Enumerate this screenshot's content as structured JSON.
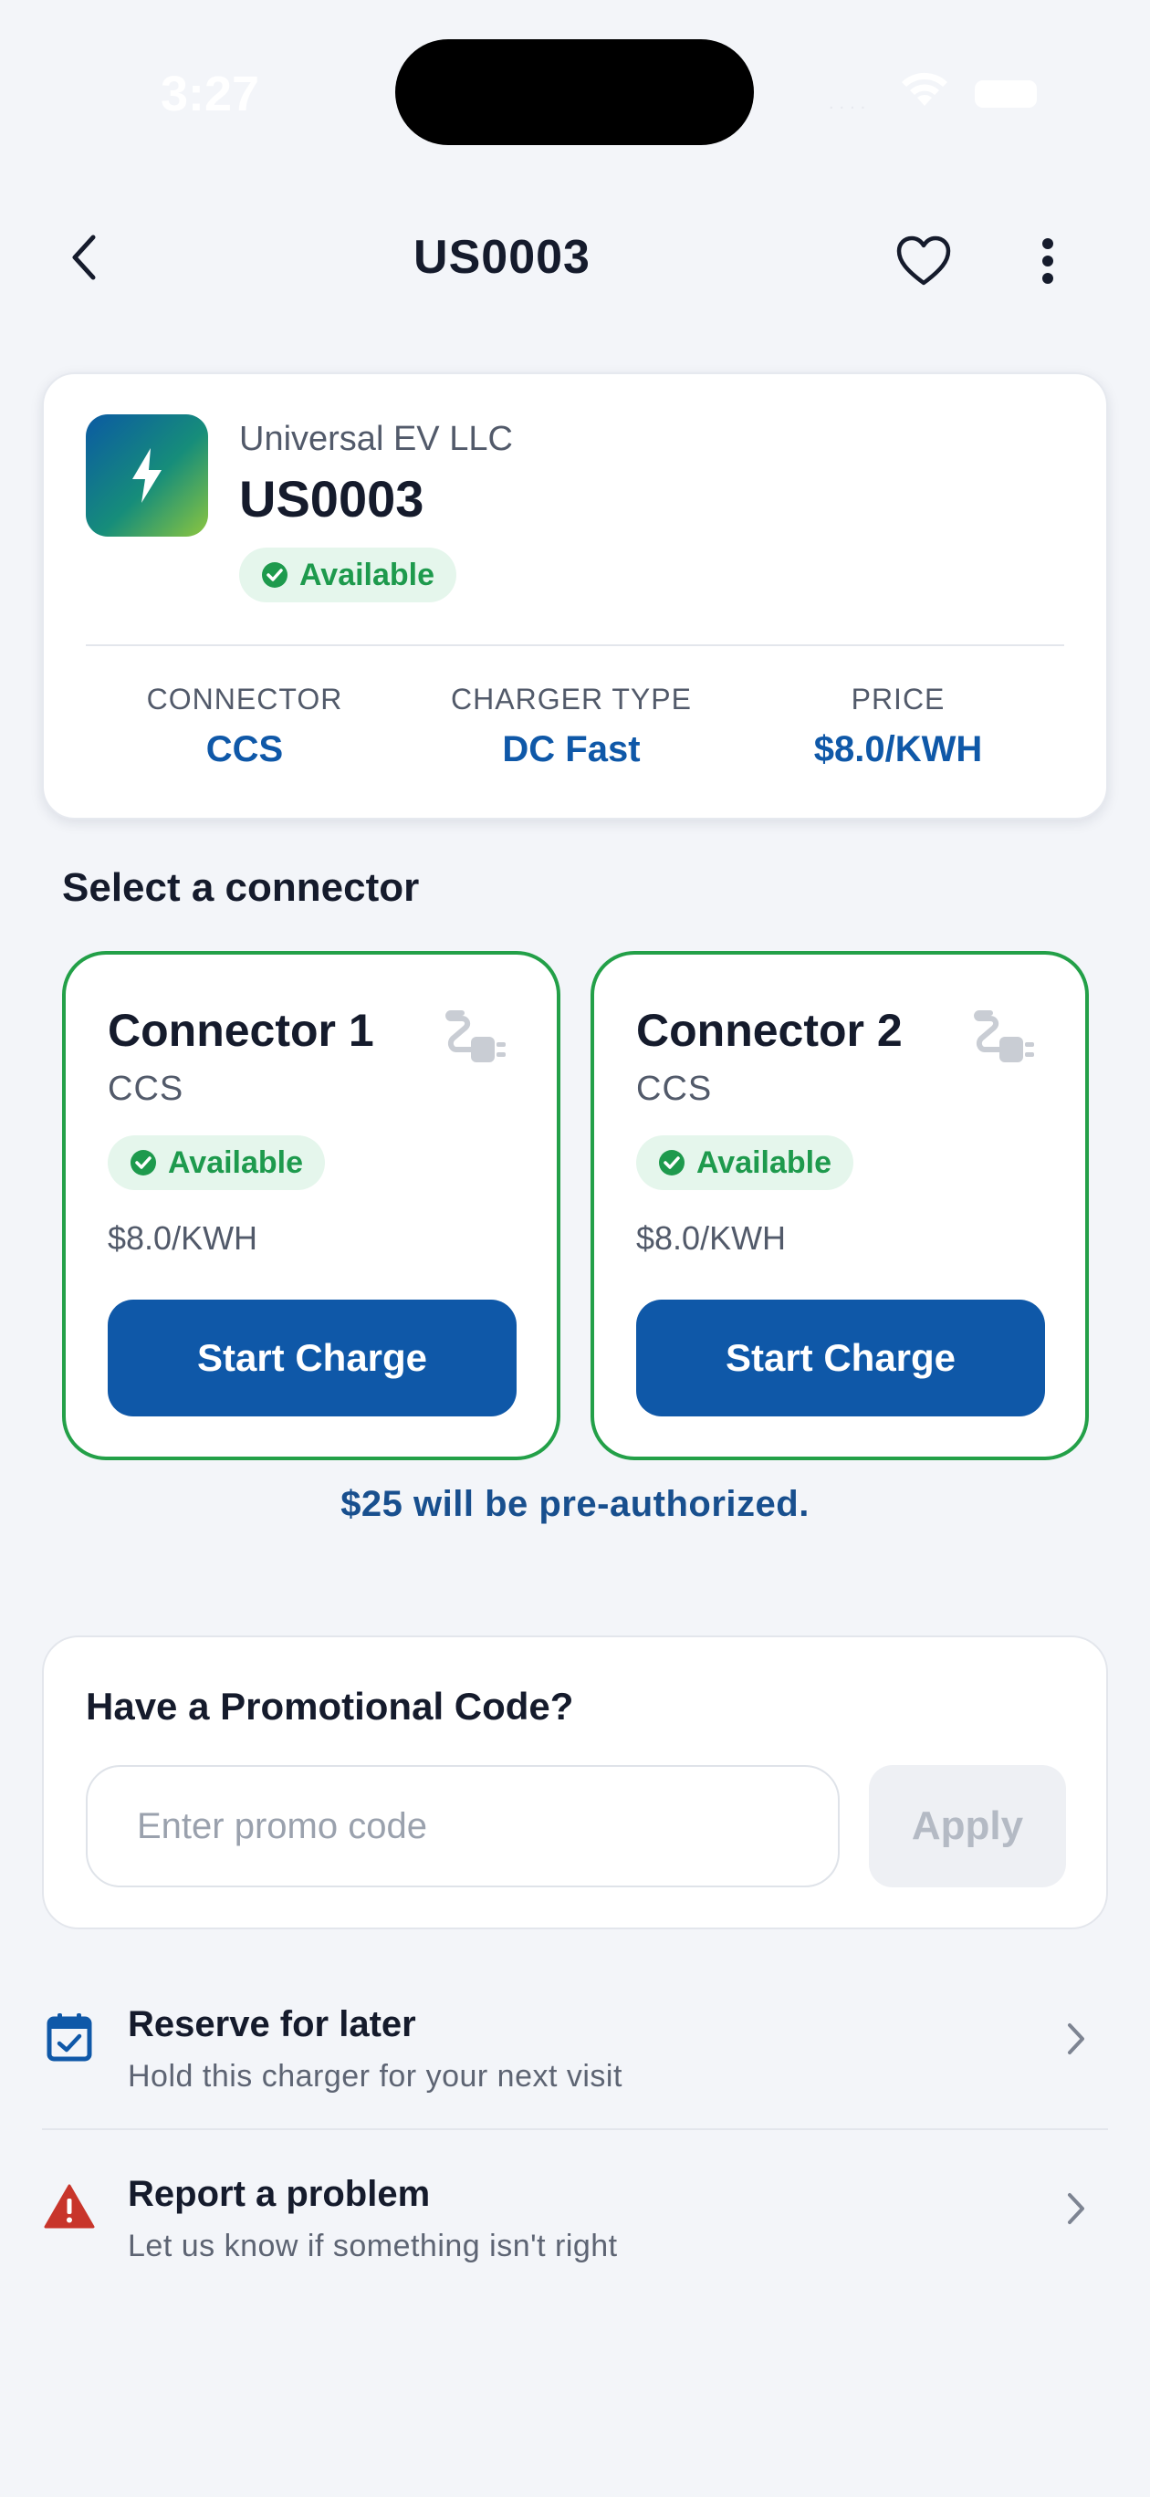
{
  "status_bar": {
    "time": "3:27",
    "signal": "...."
  },
  "header": {
    "title": "US0003"
  },
  "station": {
    "operator": "Universal EV LLC",
    "id": "US0003",
    "status": "Available",
    "info": [
      {
        "label": "CONNECTOR",
        "value": "CCS"
      },
      {
        "label": "CHARGER TYPE",
        "value": "DC Fast"
      },
      {
        "label": "PRICE",
        "value": "$8.0/KWH"
      }
    ]
  },
  "connectors_section": {
    "title": "Select a connector",
    "connectors": [
      {
        "name": "Connector 1",
        "type": "CCS",
        "status": "Available",
        "price": "$8.0/KWH",
        "button": "Start Charge"
      },
      {
        "name": "Connector 2",
        "type": "CCS",
        "status": "Available",
        "price": "$8.0/KWH",
        "button": "Start Charge"
      }
    ],
    "preauth_note": "$25 will be pre-authorized."
  },
  "promo": {
    "title": "Have a Promotional Code?",
    "value": "",
    "placeholder": "Enter promo code",
    "apply_label": "Apply"
  },
  "actions": [
    {
      "title": "Reserve for later",
      "subtitle": "Hold this charger for your next visit",
      "icon": "calendar-check-icon"
    },
    {
      "title": "Report a problem",
      "subtitle": "Let us know if something isn't right",
      "icon": "warning-icon"
    }
  ],
  "colors": {
    "primary": "#0f58a8",
    "available_green": "#1e9a4d",
    "connector_border": "#23a048",
    "warning_red": "#c8352b",
    "background": "#f3f5f9"
  }
}
